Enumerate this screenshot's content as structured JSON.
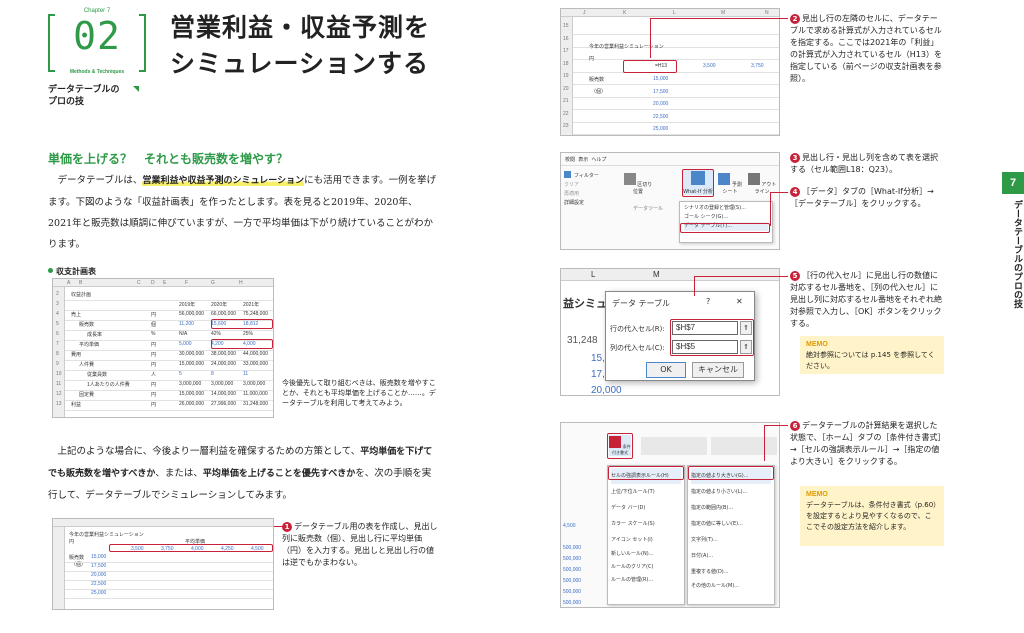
{
  "badge": {
    "chapter_label": "Chapter 7",
    "number": "02",
    "tagline": "Methods & Techniques"
  },
  "subtitle": "データテーブルの\nプロの技",
  "title_line1": "営業利益・収益予測を",
  "title_line2": "シミュレーションする",
  "heading": "単価を上げる？　それとも販売数を増やす？",
  "para1": {
    "t1": "データテーブルは、",
    "h1": "営業利益や収益予測のシミュレーション",
    "t2": "にも活用できます。一例を挙げます。下図のような「収益計画表」を作ったとします。表を見ると2019年、2020年、2021年と販売数は順調に伸びていますが、一方で平均単価は下がり続けていることがわかります。"
  },
  "figure_caption": "収支計画表",
  "figure_note": "今後優先して取り組むべきは、販売数を増やすことか、それとも平均単価を上げることか……。データテーブルを利用して考えてみよう。",
  "para2": {
    "t1": "上記のような場合に、今後より一層利益を確保するための方策として、",
    "b1": "平均単価を下げてでも販売数を増やすべきか",
    "t2": "、または、",
    "b2": "平均単価を上げることを優先すべきか",
    "t3": "を、次の手順を実行して、データテーブルでシミュレーションしてみます。"
  },
  "sheet1": {
    "cols": [
      "A",
      "B",
      "C",
      "D",
      "E",
      "F",
      "G",
      "H"
    ],
    "rows": [
      {
        "label": "収益計画",
        "indent": 0,
        "unit": "",
        "v": [
          "",
          "",
          ""
        ]
      },
      {
        "label": "",
        "indent": 0,
        "unit": "",
        "v": [
          "2019年",
          "2020年",
          "2021年"
        ]
      },
      {
        "label": "売上",
        "indent": 0,
        "unit": "円",
        "v": [
          "56,000,000",
          "66,000,000",
          "75,248,000"
        ]
      },
      {
        "label": "販売数",
        "indent": 1,
        "unit": "個",
        "v": [
          "11,200",
          "15,600",
          "18,812"
        ]
      },
      {
        "label": "成長率",
        "indent": 2,
        "unit": "%",
        "v": [
          "N/A",
          "42%",
          "25%"
        ]
      },
      {
        "label": "平均単価",
        "indent": 1,
        "unit": "円",
        "v": [
          "5,000",
          "4,200",
          "4,000"
        ]
      },
      {
        "label": "費用",
        "indent": 0,
        "unit": "円",
        "v": [
          "30,000,000",
          "38,000,000",
          "44,000,000"
        ]
      },
      {
        "label": "人件費",
        "indent": 1,
        "unit": "円",
        "v": [
          "15,000,000",
          "24,000,000",
          "33,000,000"
        ]
      },
      {
        "label": "従業員数",
        "indent": 2,
        "unit": "人",
        "v": [
          "5",
          "8",
          "11"
        ]
      },
      {
        "label": "1人あたりの人件費",
        "indent": 2,
        "unit": "円",
        "v": [
          "3,000,000",
          "3,000,000",
          "3,000,000"
        ]
      },
      {
        "label": "固定費",
        "indent": 1,
        "unit": "円",
        "v": [
          "15,000,000",
          "14,000,000",
          "11,000,000"
        ]
      },
      {
        "label": "利益",
        "indent": 0,
        "unit": "円",
        "v": [
          "26,000,000",
          "27,996,000",
          "31,248,000"
        ]
      }
    ]
  },
  "step1": {
    "num": "1",
    "text": "データテーブル用の表を作成し、見出し列に販売数（個）、見出し行に平均単価（円）を入力する。見出しと見出し行の値は逆でもかまわない。"
  },
  "sheet_small": {
    "title": "今年の営業利益シミュレーション",
    "unit": "円",
    "header": "平均単価",
    "row_header": "販売数",
    "row_unit": "（個）",
    "prices": [
      "3,500",
      "3,750",
      "4,000",
      "4,250",
      "4,500"
    ],
    "counts": [
      "15,000",
      "17,500",
      "20,000",
      "22,500",
      "25,000"
    ]
  },
  "sheet2": {
    "cols": [
      "J",
      "K",
      "L",
      "M",
      "N"
    ],
    "rows": [
      "15",
      "16",
      "17",
      "18",
      "19",
      "20",
      "21",
      "22",
      "23"
    ],
    "title": "今年の営業利益シミュレーション",
    "unit": "円",
    "formula": "=H13",
    "row_vals": [
      "3,500",
      "3,750"
    ],
    "row_header": "販売数",
    "row_unit": "（個）",
    "counts": [
      "15,000",
      "17,500",
      "20,000",
      "22,500",
      "25,000"
    ]
  },
  "step2": {
    "num": "2",
    "text": "見出し行の左隣のセルに、データテーブルで求める計算式が入力されているセルを指定する。ここでは2021年の「利益」の計算式が入力されているセル（H13）を指定している（前ページの収支計画表を参照）。"
  },
  "ribbon": {
    "tabs": [
      "校閲",
      "表示",
      "ヘルプ"
    ],
    "groups": [
      "フィルター",
      "クリア",
      "再適用",
      "詳細設定",
      "区切り位置",
      "データツール",
      "What-If 分析",
      "予測シート",
      "アウトライン"
    ],
    "group_label": "データツール",
    "menu": [
      "シナリオの登録と管理(S)...",
      "ゴール シーク(G)...",
      "データ テーブル(T)..."
    ]
  },
  "step3": {
    "num": "3",
    "text": "見出し行・見出し列を含めて表を選択する（セル範囲L18：Q23）。"
  },
  "step4": {
    "num": "4",
    "text": "［データ］タブの［What-If分析］→［データテーブル］をクリックする。"
  },
  "dialog": {
    "title": "データ テーブル",
    "row_label": "行の代入セル(R):",
    "row_value": "$H$7",
    "col_label": "列の代入セル(C):",
    "col_value": "$H$5",
    "ok": "OK",
    "cancel": "キャンセル",
    "bg_cols": [
      "L",
      "M"
    ],
    "bg_title": "益シミュ",
    "bg_value": "31,248",
    "bg_rows": [
      "15,",
      "17,",
      "20,000"
    ],
    "help": "?",
    "close": "✕"
  },
  "step5": {
    "num": "5",
    "text": "［行の代入セル］に見出し行の数値に対応するセル番地を、［列の代入セル］に見出し列に対応するセル番地をそれぞれ絶対参照で入力し、［OK］ボタンをクリックする。"
  },
  "memo1": {
    "label": "MEMO",
    "text": "絶対参照については p.145 を参照してください。"
  },
  "cf": {
    "menu": [
      "セルの強調表示ルール(H)",
      "上位/下位ルール(T)",
      "データ バー(D)",
      "カラー スケール(S)",
      "アイコン セット(I)",
      "新しいルール(N)...",
      "ルールのクリア(C)",
      "ルールの管理(R)..."
    ],
    "submenu": [
      "指定の値より大きい(G)...",
      "指定の値より小さい(L)...",
      "指定の範囲内(B)...",
      "指定の値に等しい(E)...",
      "文字列(T)...",
      "日付(A)...",
      "重複する値(D)...",
      "その他のルール(M)..."
    ],
    "ribbon_btn": "条件付き書式",
    "values": [
      "4,500",
      "",
      "500,000",
      "500,000",
      "500,000",
      "500,000",
      "500,000",
      "500,000"
    ]
  },
  "step6": {
    "num": "6",
    "text": "データテーブルの計算結果を選択した状態で、［ホーム］タブの［条件付き書式］→［セルの強調表示ルール］→［指定の値より大きい］をクリックする。"
  },
  "memo2": {
    "label": "MEMO",
    "text": "データテーブルは、条件付き書式（p.60）を設定するとより見やすくなるので、ここでその設定方法を紹介します。"
  },
  "tab": {
    "number": "7",
    "label": "データテーブルのプロの技"
  },
  "colors": {
    "accent": "#2e9a48",
    "marker": "#c8213a",
    "highlight": "#f7ef6a",
    "memo_bg": "#fff4c9"
  }
}
